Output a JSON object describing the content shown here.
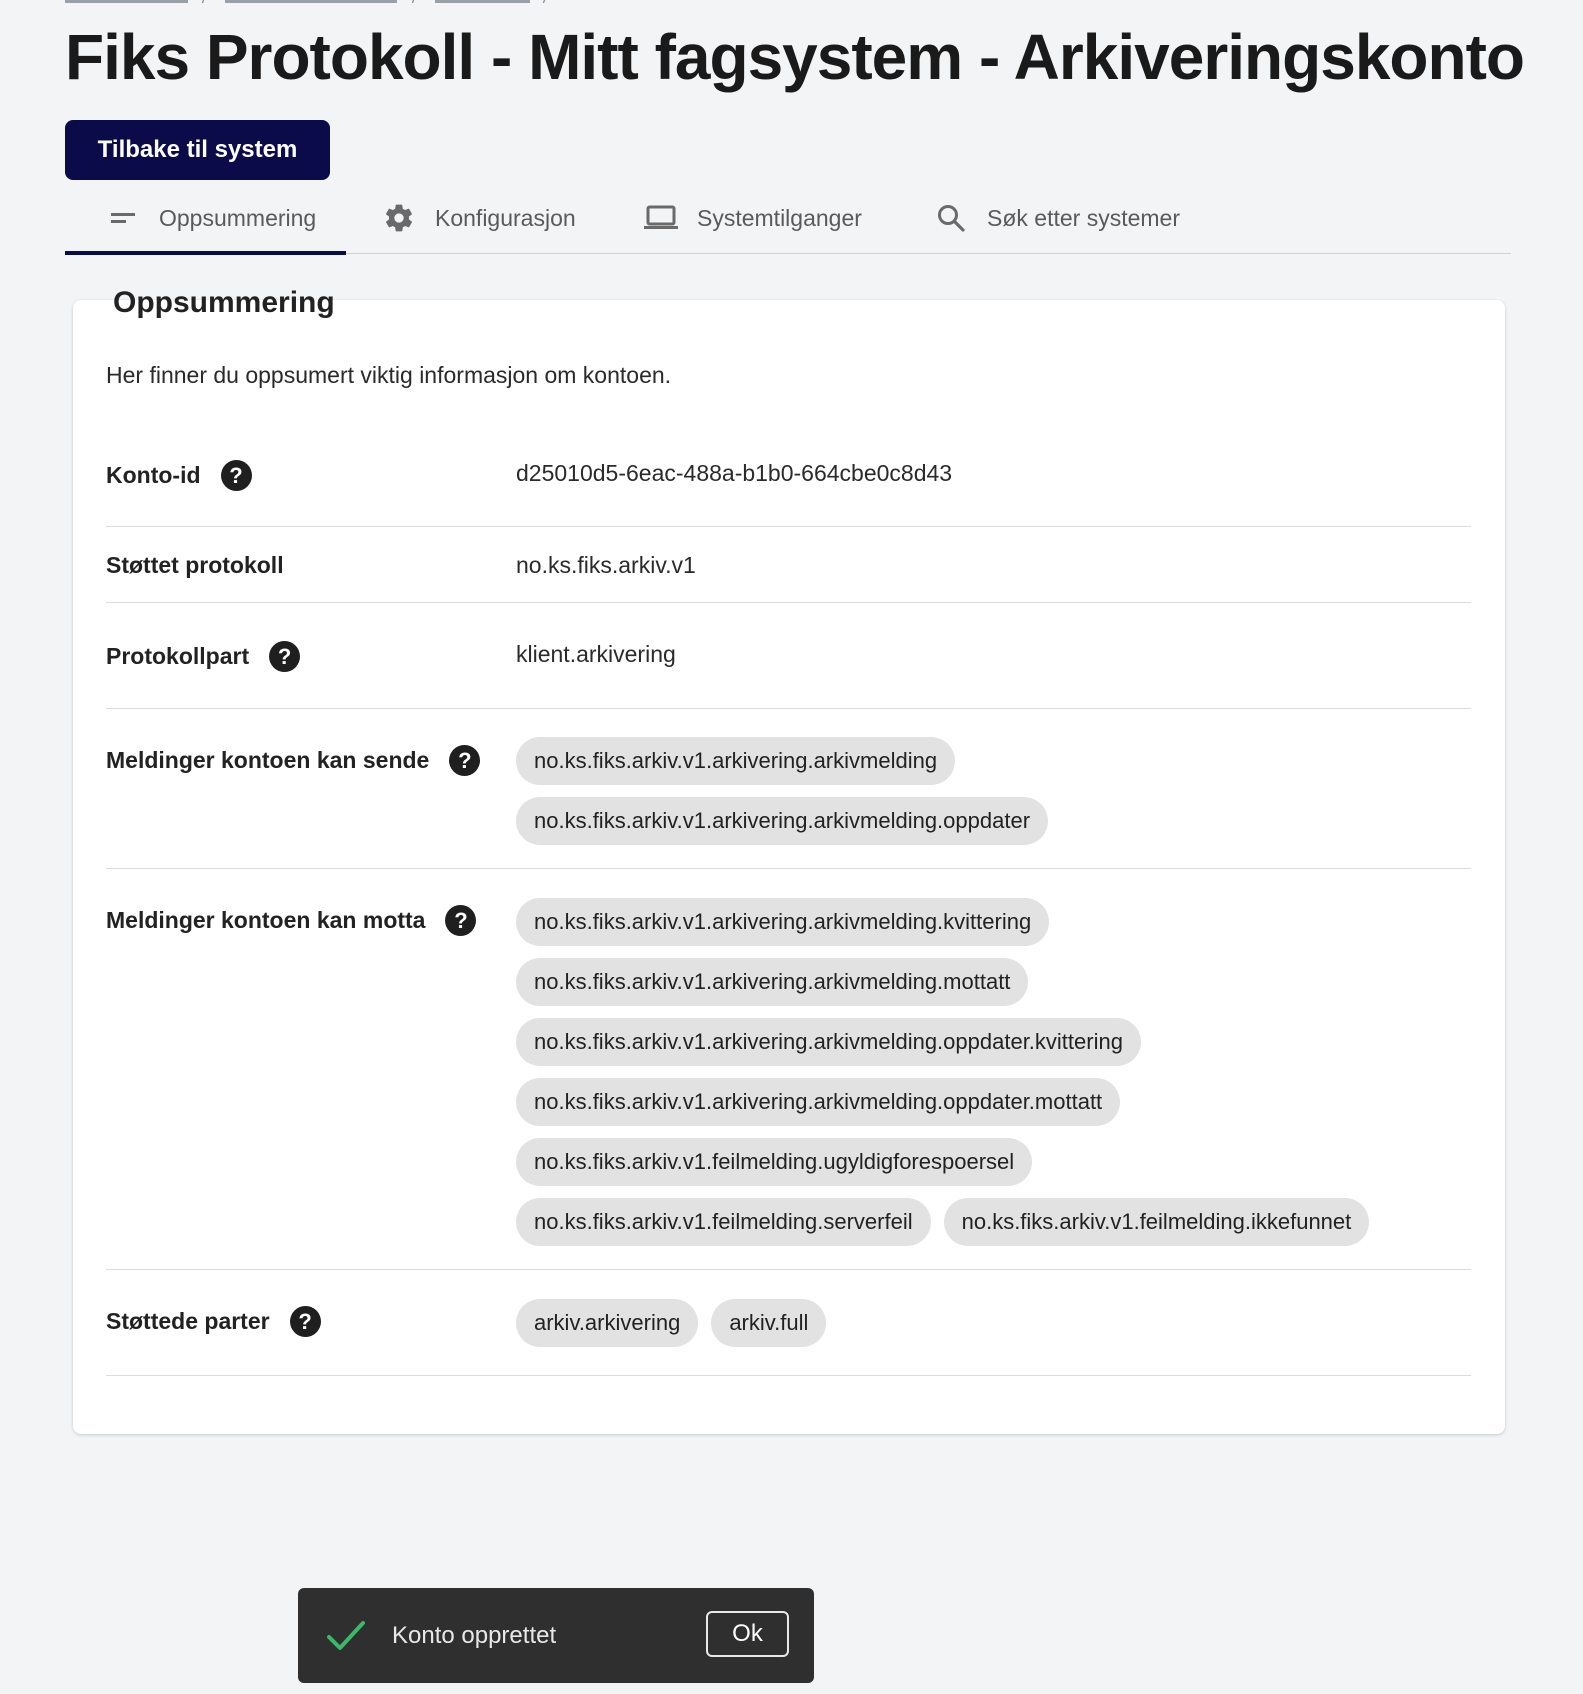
{
  "page": {
    "title": "Fiks Protokoll - Mitt fagsystem - Arkiveringskonto",
    "back_button": "Tilbake til system"
  },
  "tabs": [
    {
      "label": "Oppsummering",
      "icon": "short-text-icon",
      "active": true
    },
    {
      "label": "Konfigurasjon",
      "icon": "gear-icon",
      "active": false
    },
    {
      "label": "Systemtilganger",
      "icon": "laptop-icon",
      "active": false
    },
    {
      "label": "Søk etter systemer",
      "icon": "search-icon",
      "active": false
    }
  ],
  "summary": {
    "heading": "Oppsummering",
    "intro": "Her finner du oppsumert viktig informasjon om kontoen.",
    "help_glyph": "?",
    "rows": {
      "konto_id": {
        "label": "Konto-id",
        "value": "d25010d5-6eac-488a-b1b0-664cbe0c8d43"
      },
      "protokoll": {
        "label": "Støttet protokoll",
        "value": "no.ks.fiks.arkiv.v1"
      },
      "protokollpart": {
        "label": "Protokollpart",
        "value": "klient.arkivering"
      },
      "sende": {
        "label": "Meldinger kontoen kan sende",
        "chips": [
          "no.ks.fiks.arkiv.v1.arkivering.arkivmelding",
          "no.ks.fiks.arkiv.v1.arkivering.arkivmelding.oppdater"
        ]
      },
      "motta": {
        "label": "Meldinger kontoen kan motta",
        "chips": [
          "no.ks.fiks.arkiv.v1.arkivering.arkivmelding.kvittering",
          "no.ks.fiks.arkiv.v1.arkivering.arkivmelding.mottatt",
          "no.ks.fiks.arkiv.v1.arkivering.arkivmelding.oppdater.kvittering",
          "no.ks.fiks.arkiv.v1.arkivering.arkivmelding.oppdater.mottatt",
          "no.ks.fiks.arkiv.v1.feilmelding.ugyldigforespoersel",
          "no.ks.fiks.arkiv.v1.feilmelding.serverfeil",
          "no.ks.fiks.arkiv.v1.feilmelding.ikkefunnet"
        ]
      },
      "parter": {
        "label": "Støttede parter",
        "chips": [
          "arkiv.arkivering",
          "arkiv.full"
        ]
      }
    }
  },
  "snackbar": {
    "message": "Konto opprettet",
    "ok_label": "Ok",
    "icon": "check-icon",
    "check_color": "#3bb86a"
  },
  "colors": {
    "primary": "#0b0b4a",
    "background": "#f3f4f6",
    "chip": "#e2e2e2"
  }
}
